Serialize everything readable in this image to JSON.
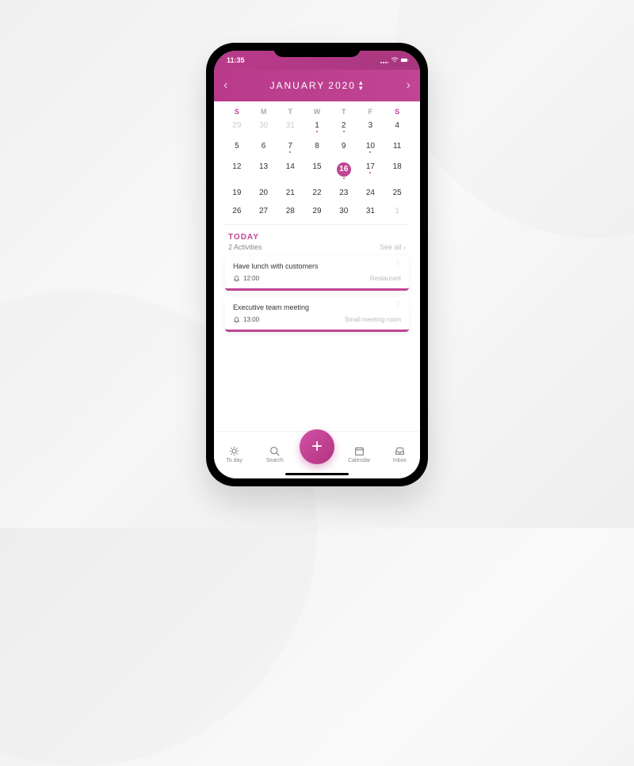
{
  "status": {
    "time": "11:35",
    "signal": "●●●●",
    "wifi": "wifi",
    "battery": "batt"
  },
  "header": {
    "month": "JANUARY",
    "year": "2020"
  },
  "weekdays": [
    "S",
    "M",
    "T",
    "W",
    "T",
    "F",
    "S"
  ],
  "calendar": {
    "rows": [
      [
        {
          "n": "29",
          "out": true
        },
        {
          "n": "30",
          "out": true
        },
        {
          "n": "31",
          "out": true
        },
        {
          "n": "1",
          "dot": true
        },
        {
          "n": "2",
          "dot": true
        },
        {
          "n": "3"
        },
        {
          "n": "4"
        }
      ],
      [
        {
          "n": "5"
        },
        {
          "n": "6"
        },
        {
          "n": "7",
          "dot": true
        },
        {
          "n": "8"
        },
        {
          "n": "9"
        },
        {
          "n": "10",
          "dot": true
        },
        {
          "n": "11"
        }
      ],
      [
        {
          "n": "12"
        },
        {
          "n": "13"
        },
        {
          "n": "14"
        },
        {
          "n": "15"
        },
        {
          "n": "16",
          "selected": true,
          "dot": true
        },
        {
          "n": "17",
          "dot": true
        },
        {
          "n": "18"
        }
      ],
      [
        {
          "n": "19"
        },
        {
          "n": "20"
        },
        {
          "n": "21"
        },
        {
          "n": "22"
        },
        {
          "n": "23"
        },
        {
          "n": "24"
        },
        {
          "n": "25"
        }
      ],
      [
        {
          "n": "26"
        },
        {
          "n": "27"
        },
        {
          "n": "28"
        },
        {
          "n": "29"
        },
        {
          "n": "30"
        },
        {
          "n": "31"
        },
        {
          "n": "1",
          "out": true
        }
      ]
    ]
  },
  "today": {
    "title": "TODAY",
    "subtitle": "2 Activities",
    "see_all": "See all"
  },
  "events": [
    {
      "title": "Have lunch with customers",
      "time": "12:00",
      "location": "Restaurant"
    },
    {
      "title": "Executive team meeting",
      "time": "13:00",
      "location": "Small meeting room"
    }
  ],
  "nav": {
    "today": "To day",
    "search": "Search",
    "calendar": "Calendar",
    "inbox": "Inbox"
  }
}
